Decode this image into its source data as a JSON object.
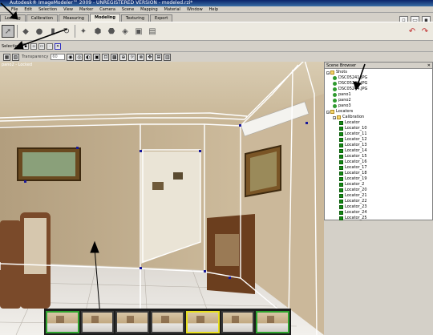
{
  "window": {
    "title": "Autodesk® ImageModeler™ 2009 - UNREGISTERED VERSION - modeled.rzi*"
  },
  "menubar": [
    "File",
    "Edit",
    "Selection",
    "View",
    "Marker",
    "Camera",
    "Scene",
    "Mapping",
    "Material",
    "Window",
    "Help"
  ],
  "tabs": [
    {
      "label": "Loading",
      "active": false
    },
    {
      "label": "Calibration",
      "active": false
    },
    {
      "label": "Measuring",
      "active": false
    },
    {
      "label": "Modeling",
      "active": true
    },
    {
      "label": "Texturing",
      "active": false
    },
    {
      "label": "Export",
      "active": false
    }
  ],
  "selection_bar": {
    "label": "Selection"
  },
  "view_toolbar": {
    "transparency_label": "Transparency",
    "transparency_value": "60"
  },
  "viewport": {
    "label": "pano2 - Locked"
  },
  "scene_browser": {
    "title": "Scene Browser",
    "tree": [
      {
        "level": 0,
        "icon": "folder",
        "label": "Shots"
      },
      {
        "level": 1,
        "icon": "green",
        "label": "DSC05241.JPG"
      },
      {
        "level": 1,
        "icon": "green",
        "label": "DSC05242.JPG"
      },
      {
        "level": 1,
        "icon": "green",
        "label": "DSC05244.JPG"
      },
      {
        "level": 1,
        "icon": "green",
        "label": "pano1"
      },
      {
        "level": 1,
        "icon": "green",
        "label": "pano2"
      },
      {
        "level": 1,
        "icon": "green",
        "label": "pano3"
      },
      {
        "level": 0,
        "icon": "folder",
        "label": "Locators"
      },
      {
        "level": 1,
        "icon": "folder",
        "label": "Calibration"
      },
      {
        "level": 2,
        "icon": "loc",
        "label": "Locator"
      },
      {
        "level": 2,
        "icon": "loc",
        "label": "Locator_10"
      },
      {
        "level": 2,
        "icon": "loc",
        "label": "Locator_11"
      },
      {
        "level": 2,
        "icon": "loc",
        "label": "Locator_12"
      },
      {
        "level": 2,
        "icon": "loc",
        "label": "Locator_13"
      },
      {
        "level": 2,
        "icon": "loc",
        "label": "Locator_14"
      },
      {
        "level": 2,
        "icon": "loc",
        "label": "Locator_15"
      },
      {
        "level": 2,
        "icon": "loc",
        "label": "Locator_16"
      },
      {
        "level": 2,
        "icon": "loc",
        "label": "Locator_17"
      },
      {
        "level": 2,
        "icon": "loc",
        "label": "Locator_18"
      },
      {
        "level": 2,
        "icon": "loc",
        "label": "Locator_19"
      },
      {
        "level": 2,
        "icon": "loc",
        "label": "Locator_2"
      },
      {
        "level": 2,
        "icon": "loc",
        "label": "Locator_20"
      },
      {
        "level": 2,
        "icon": "loc",
        "label": "Locator_21"
      },
      {
        "level": 2,
        "icon": "loc",
        "label": "Locator_22"
      },
      {
        "level": 2,
        "icon": "loc",
        "label": "Locator_23"
      },
      {
        "level": 2,
        "icon": "loc",
        "label": "Locator_24"
      },
      {
        "level": 2,
        "icon": "loc",
        "label": "Locator_25"
      }
    ]
  },
  "filmstrip": {
    "thumbnails": [
      {
        "highlight": "green"
      },
      {
        "highlight": "none"
      },
      {
        "highlight": "none"
      },
      {
        "highlight": "none"
      },
      {
        "highlight": "yellow"
      },
      {
        "highlight": "none"
      },
      {
        "highlight": "green"
      }
    ]
  }
}
